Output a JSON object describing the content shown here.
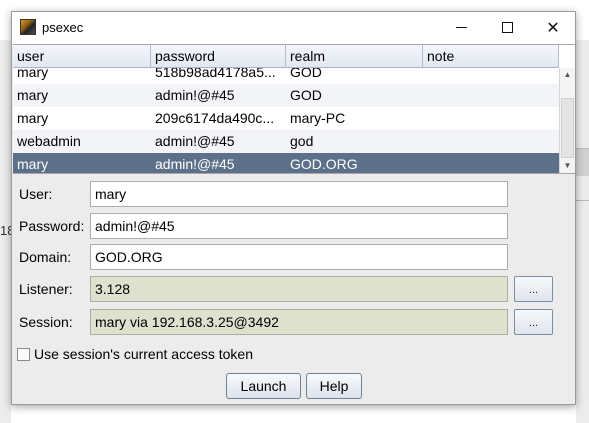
{
  "background": {
    "fragment_text": "18"
  },
  "window": {
    "title": "psexec",
    "icon": "psexec-app-icon",
    "controls": {
      "minimize": "minimize-icon",
      "maximize": "maximize-icon",
      "close": "close-icon",
      "close_glyph": "✕"
    }
  },
  "table": {
    "columns": [
      "user",
      "password",
      "realm",
      "note"
    ],
    "rows": [
      {
        "user": "mary",
        "password": "518b98ad4178a5...",
        "realm": "GOD",
        "note": ""
      },
      {
        "user": "mary",
        "password": "admin!@#45",
        "realm": "GOD",
        "note": ""
      },
      {
        "user": "mary",
        "password": "209c6174da490c...",
        "realm": "mary-PC",
        "note": ""
      },
      {
        "user": "webadmin",
        "password": "admin!@#45",
        "realm": "god",
        "note": ""
      },
      {
        "user": "mary",
        "password": "admin!@#45",
        "realm": "GOD.ORG",
        "note": ""
      }
    ],
    "selected_index": 4,
    "scroll": {
      "up_glyph": "▲",
      "down_glyph": "▼"
    }
  },
  "form": {
    "user_label": "User:",
    "user_value": "mary",
    "password_label": "Password:",
    "password_value": "admin!@#45",
    "domain_label": "Domain:",
    "domain_value": "GOD.ORG",
    "listener_label": "Listener:",
    "listener_value": "3.128",
    "session_label": "Session:",
    "session_value": "mary via  192.168.3.25@3492",
    "browse_label": "...",
    "checkbox_label": "Use session's current access token",
    "checkbox_checked": false
  },
  "buttons": {
    "launch": "Launch",
    "help": "Help"
  },
  "colors": {
    "selected_row": "#5c7189",
    "readonly_field": "#dde1cd",
    "header": "#e2e8f1"
  }
}
